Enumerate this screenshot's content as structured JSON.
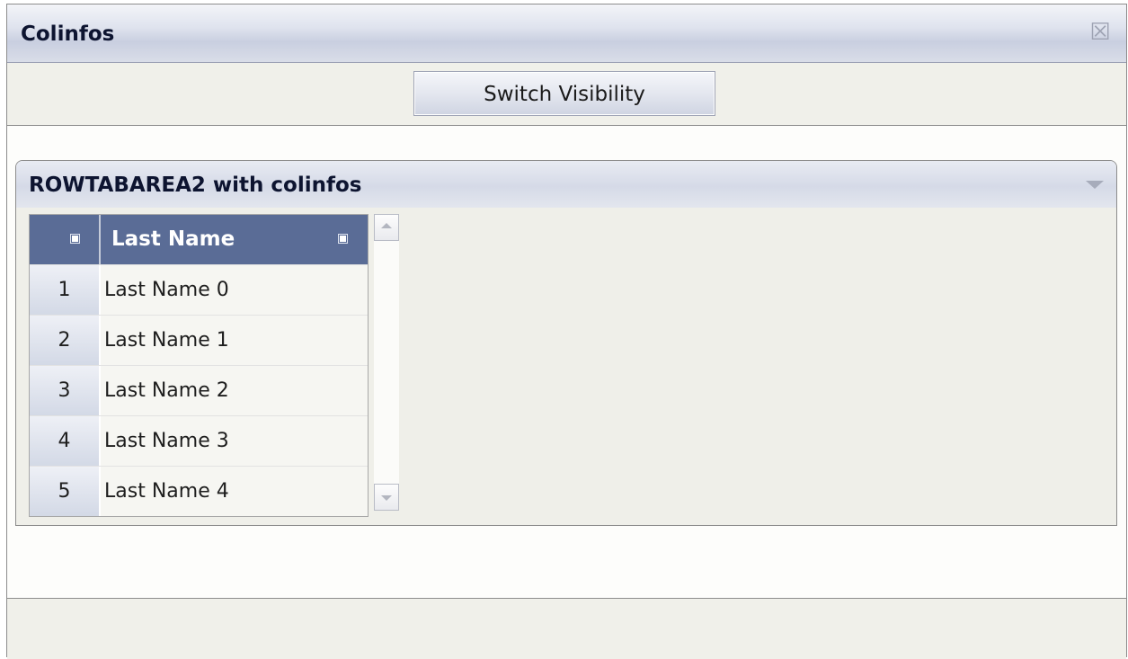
{
  "window": {
    "title": "Colinfos",
    "close_icon": "close-icon"
  },
  "toolbar": {
    "switch_label": "Switch Visibility"
  },
  "rowarea": {
    "title": "ROWTABAREA2 with colinfos",
    "collapse_icon": "chevron-down-icon"
  },
  "grid": {
    "columns": [
      "",
      "Last Name"
    ],
    "rows": [
      {
        "num": "1",
        "value": "Last Name 0"
      },
      {
        "num": "2",
        "value": "Last Name 1"
      },
      {
        "num": "3",
        "value": "Last Name 2"
      },
      {
        "num": "4",
        "value": "Last Name 3"
      },
      {
        "num": "5",
        "value": "Last Name 4"
      }
    ]
  }
}
